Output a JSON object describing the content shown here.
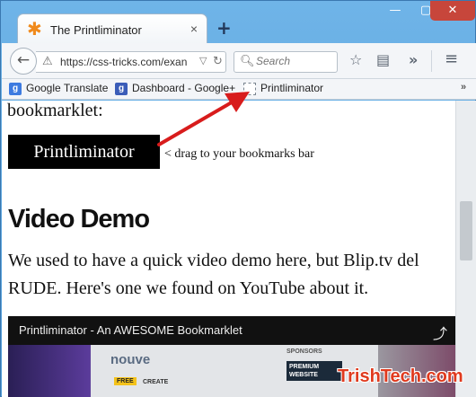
{
  "window": {
    "minimize_glyph": "—",
    "maximize_glyph": "▢",
    "close_glyph": "✕"
  },
  "tab": {
    "favicon": "✱",
    "title": "The Printliminator",
    "close_glyph": "×",
    "new_tab_glyph": "+"
  },
  "toolbar": {
    "back_glyph": "←",
    "url": "https://css-tricks.com/exan",
    "url_icon": "⚠",
    "url_drop_glyph": "▽",
    "url_reload_glyph": "↻",
    "search_placeholder": "Search",
    "search_icon_glyph": "🔍︎",
    "bookmark_star_glyph": "☆",
    "reader_glyph": "▤",
    "overflow_glyph": "»",
    "menu_glyph": "≡"
  },
  "bookmarks": {
    "items": [
      {
        "label": "Google Translate",
        "icon": "g"
      },
      {
        "label": "Dashboard - Google+",
        "icon": "g"
      },
      {
        "label": "Printliminator",
        "icon": ""
      }
    ],
    "more_glyph": "»"
  },
  "content": {
    "lead_word": "bookmarklet:",
    "button_label": "Printliminator",
    "drag_hint": "< drag to your bookmarks bar",
    "heading": "Video Demo",
    "paragraph_line1": "We used to have a quick video demo here, but Blip.tv del",
    "paragraph_line2": "RUDE. Here's one we found on YouTube about it."
  },
  "video": {
    "title": "Printliminator - An AWESOME Bookmarklet",
    "share_glyph": "⤴",
    "thumb_logo": "nouve",
    "sponsors_label": "SPONSORS",
    "premium_label": "PREMIUM WEBSITE",
    "free_label": "FREE",
    "create_label": "CREATE"
  },
  "watermark": "TrishTech.com",
  "colors": {
    "frame": "#5ba3dc",
    "close_button": "#c7463b",
    "arrow": "#d81c1c",
    "watermark": "#e03a1e"
  }
}
